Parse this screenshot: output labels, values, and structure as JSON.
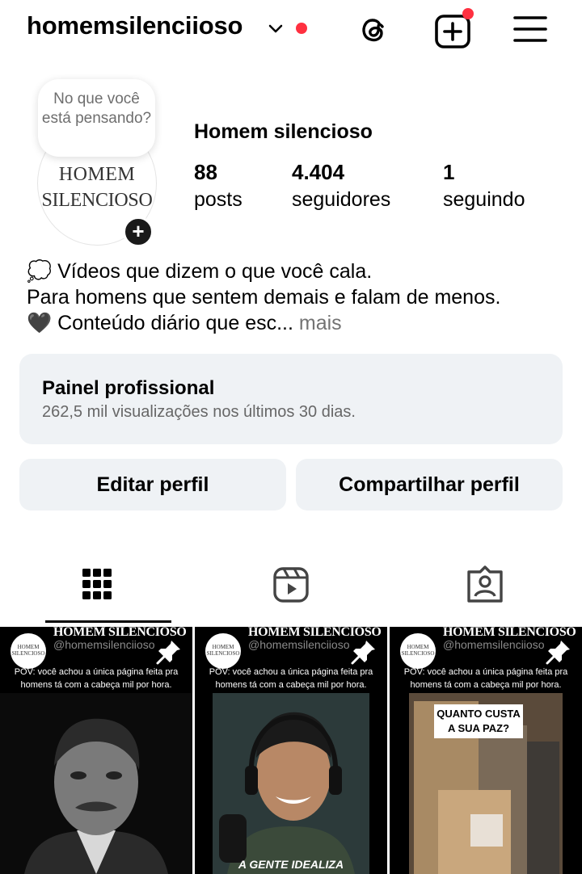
{
  "header": {
    "username": "homemsilenciioso"
  },
  "profile": {
    "note_bubble": "No que você está pensando?",
    "avatar_line1": "HOMEM",
    "avatar_line2": "SILENCIOSO",
    "avatar_add": "+",
    "display_name": "Homem silencioso",
    "stats": [
      {
        "value": "88",
        "label": "posts"
      },
      {
        "value": "4.404",
        "label": "seguidores"
      },
      {
        "value": "1",
        "label": "seguindo"
      }
    ],
    "bio_line1": "💭 Vídeos que dizem o que você cala.",
    "bio_line2": "Para homens que sentem demais e falam de menos.",
    "bio_line3": "🖤 Conteúdo diário que esc...",
    "bio_more": " mais"
  },
  "panel": {
    "title": "Painel profissional",
    "subtitle": "262,5 mil visualizações nos últimos 30 dias."
  },
  "actions": {
    "edit": "Editar perfil",
    "share": "Compartilhar perfil"
  },
  "posts": [
    {
      "brand": "HOMEM SILENCIOSO",
      "logo": "HOMEM SILENCIOSO",
      "handle": "@homemsilenciioso",
      "caption": "POV: você achou a única página feita pra homens tá com a cabeça mil por hora.",
      "overlay": ""
    },
    {
      "brand": "HOMEM SILENCIOSO",
      "logo": "HOMEM SILENCIOSO",
      "handle": "@homemsilenciioso",
      "caption": "POV: você achou a única página feita pra homens tá com a cabeça mil por hora.",
      "overlay": "A GENTE IDEALIZA"
    },
    {
      "brand": "HOMEM SILENCIOSO",
      "logo": "HOMEM SILENCIOSO",
      "handle": "@homemsilenciioso",
      "caption": "POV: você achou a única página feita pra homens tá com a cabeça mil por hora.",
      "overlay": "QUANTO CUSTA A SUA PAZ?"
    }
  ],
  "colors": {
    "accent_red": "#ff3040",
    "panel_bg": "#eff2f5"
  }
}
